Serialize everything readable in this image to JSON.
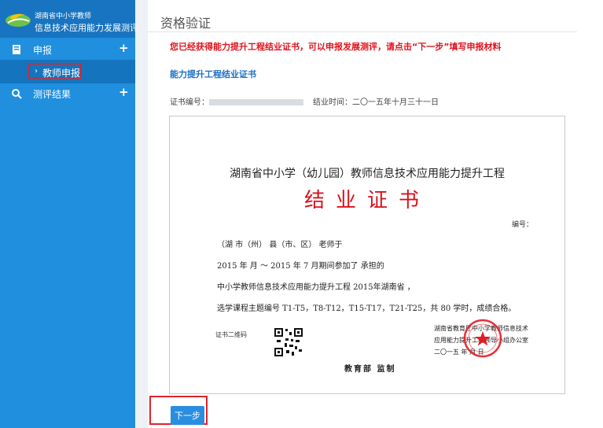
{
  "sidebar": {
    "logo_line1": "湖南省中小学教师",
    "logo_line2": "信息技术应用能力发展测评",
    "groups": [
      {
        "label": "申报",
        "expander": "+",
        "icon": "document-icon"
      },
      {
        "label": "测评结果",
        "expander": "+",
        "icon": "search-icon"
      }
    ],
    "active_item": {
      "label": "教师申报",
      "arrow": "›"
    }
  },
  "main": {
    "title": "资格验证",
    "notice": "您已经获得能力提升工程结业证书，可以申报发展测评，请点击“下一步”填写申报材料",
    "cert_link": "能力提升工程结业证书",
    "cert_number_label": "证书编号：",
    "completion_label": "结业时间：",
    "completion_value": "二〇一五年十月三十一日",
    "next_button": "下一步"
  },
  "certificate": {
    "title": "湖南省中小学（幼儿园）教师信息技术应用能力提升工程",
    "main": "结业证书",
    "number_label": "编号：",
    "line1": "（湖    市（州）      县（市、区）                              老师于",
    "line2": "2015 年    月 ～ 2015 年 7 月期间参加了                                  承担的",
    "line3": "中小学教师信息技术应用能力提升工程                 2015年湖南省       ，",
    "line4": "选学课程主题编号 T1-T5，T8-T12，T15-T17，T21-T25，共 80 学时，成绩合格。",
    "qr_label": "证书二维码",
    "issuer_line1": "湖南省教育厅中小学教师信息技术",
    "issuer_line2": "应用能力提升工程领导小组办公室",
    "issuer_date": "二〇一五 年           月        日",
    "sign": "教育部 监制"
  },
  "colors": {
    "sidebar": "#1f8fde",
    "notice": "#e0141e",
    "link": "#1b6fc3",
    "highlight_box": "#e0242b",
    "button": "#2a8ee0"
  }
}
